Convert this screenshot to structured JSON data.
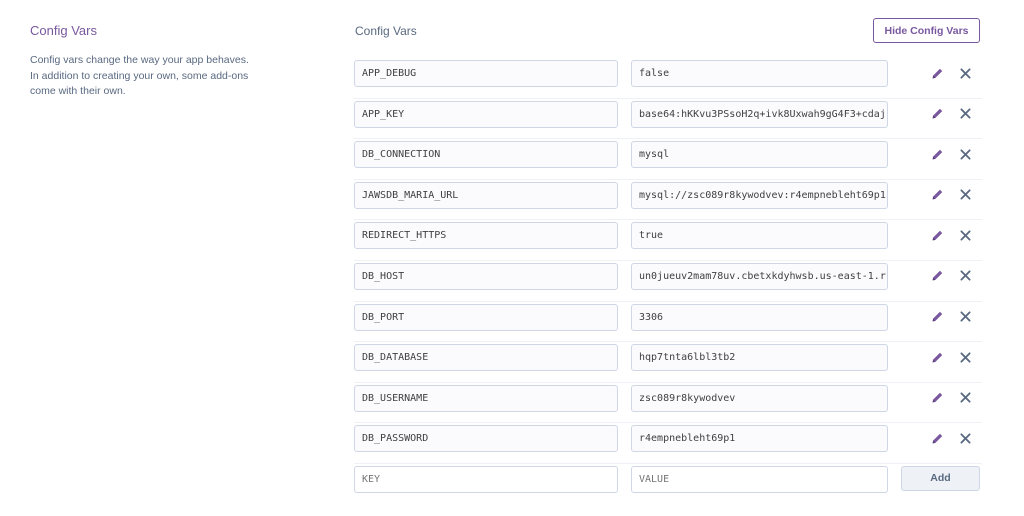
{
  "info": {
    "title": "Config Vars",
    "description": "Config vars change the way your app behaves. In addition to creating your own, some add-ons come with their own."
  },
  "panel": {
    "title": "Config Vars",
    "hide_button": "Hide Config Vars"
  },
  "vars": [
    {
      "key": "APP_DEBUG",
      "value": "false"
    },
    {
      "key": "APP_KEY",
      "value": "base64:hKKvu3PSsoH2q+ivk8Uxwah9gG4F3+cdaj"
    },
    {
      "key": "DB_CONNECTION",
      "value": "mysql"
    },
    {
      "key": "JAWSDB_MARIA_URL",
      "value": "mysql://zsc089r8kywodvev:r4empnebleht69p1"
    },
    {
      "key": "REDIRECT_HTTPS",
      "value": "true"
    },
    {
      "key": "DB_HOST",
      "value": "un0jueuv2mam78uv.cbetxkdyhwsb.us-east-1.r"
    },
    {
      "key": "DB_PORT",
      "value": "3306"
    },
    {
      "key": "DB_DATABASE",
      "value": "hqp7tnta6lbl3tb2"
    },
    {
      "key": "DB_USERNAME",
      "value": "zsc089r8kywodvev"
    },
    {
      "key": "DB_PASSWORD",
      "value": "r4empnebleht69p1"
    }
  ],
  "new_var": {
    "key_placeholder": "KEY",
    "value_placeholder": "VALUE",
    "add_button": "Add"
  },
  "icons": {
    "edit": "pencil-icon",
    "remove": "close-icon"
  },
  "colors": {
    "accent": "#79589f",
    "icon": "#596981",
    "border": "#cfd7e6"
  }
}
